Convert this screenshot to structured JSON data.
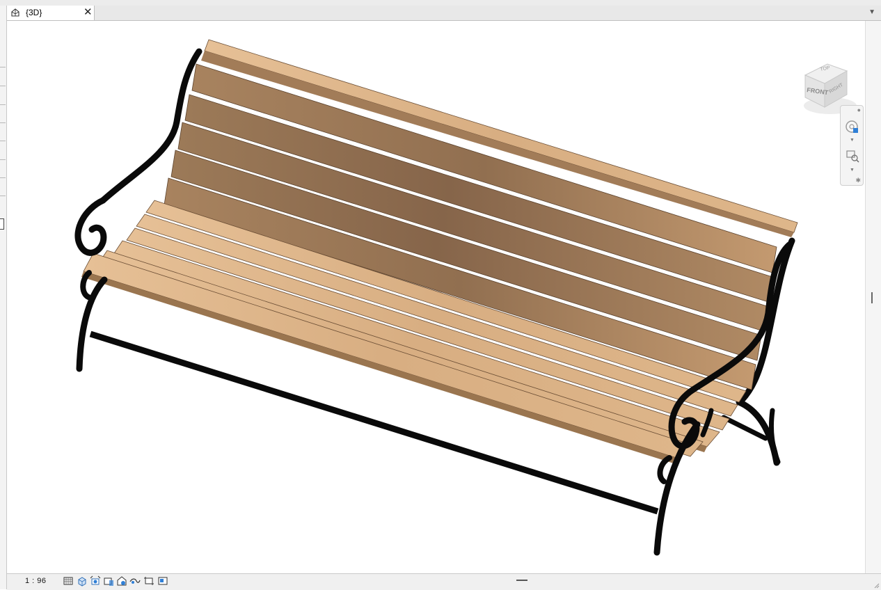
{
  "tab": {
    "label": "{3D}",
    "close": "✕",
    "menu": "▼"
  },
  "viewcube": {
    "front_label": "FRONT",
    "top_label": "TOP",
    "right_label": "RIGHT"
  },
  "status": {
    "scale": "1 : 96"
  },
  "icons": {
    "tab": "3d-house-icon",
    "statusbar": [
      "detail-level-icon",
      "visual-style-icon",
      "sun-path-icon",
      "shadows-icon",
      "render-icon",
      "crop-view-icon",
      "show-crop-icon",
      "temporary-hide-icon"
    ]
  },
  "colors": {
    "wood_light": "#dcb386",
    "wood_mid": "#c89a6c",
    "wood_dark": "#8e6b4c",
    "iron": "#0a0a0a",
    "accent_blue": "#2f7fd6"
  }
}
